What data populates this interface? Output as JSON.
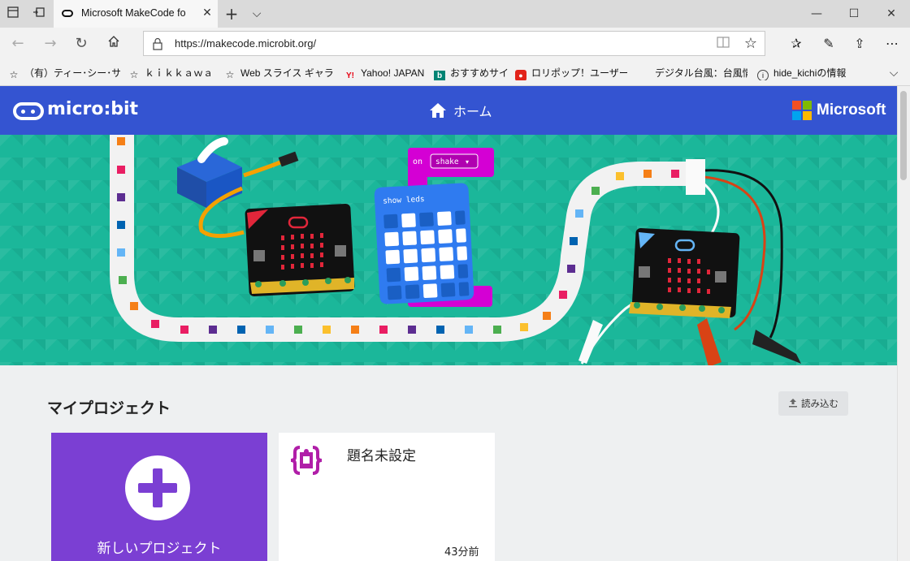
{
  "browser": {
    "tab_title": "Microsoft MakeCode fo",
    "url": "https://makecode.microbit.org/",
    "icons": {
      "set_aside": "tabs-aside-icon",
      "tab_preview": "tab-preview-icon",
      "new_tab": "plus-icon",
      "tab_menu": "chevron-down-icon",
      "back": "back-arrow-icon",
      "forward": "forward-arrow-icon",
      "refresh": "refresh-icon",
      "home": "home-icon",
      "lock": "lock-icon",
      "reading_view": "reading-view-icon",
      "favorite": "star-icon",
      "favorites": "favorites-list-icon",
      "notes": "pen-icon",
      "share": "share-icon",
      "more": "more-icon"
    }
  },
  "favorites": [
    {
      "label": "（有）ティー･シー･サービ",
      "icon": "star-icon"
    },
    {
      "label": "ｋｉｋｋａｗａ",
      "icon": "star-icon"
    },
    {
      "label": "Web スライス ギャラリー",
      "icon": "star-icon"
    },
    {
      "label": "Yahoo! JAPAN",
      "icon": "yahoo-icon"
    },
    {
      "label": "おすすめサイト",
      "icon": "bing-icon"
    },
    {
      "label": "ロリポップ！ユーザー専用",
      "icon": "lolipop-icon"
    },
    {
      "label": "デジタル台風：台風情報",
      "icon": ""
    },
    {
      "label": "hide_kichiの情報",
      "icon": "info-icon"
    }
  ],
  "makecode": {
    "logo_text": "micro:bit",
    "home_label": "ホーム",
    "ms_text": "Microsoft",
    "ms_colors": [
      "#f25022",
      "#7fba00",
      "#00a4ef",
      "#ffb900"
    ],
    "header_color": "#3454d1",
    "hero_color": "#1bb79a",
    "hero_blocks": {
      "event": "on",
      "event_value": "shake",
      "block": "show leds"
    },
    "section_title": "マイプロジェクト",
    "import_label": "読み込む",
    "new_project_label": "新しいプロジェクト",
    "project": {
      "title": "題名未設定",
      "time": "43分前"
    }
  }
}
